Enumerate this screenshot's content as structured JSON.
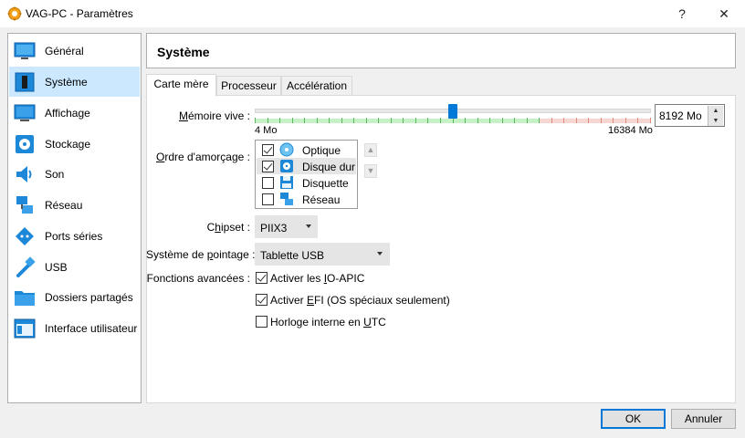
{
  "window": {
    "title": "VAG-PC - Paramètres",
    "help_glyph": "?",
    "close_glyph": "✕"
  },
  "sidebar": {
    "items": [
      {
        "label": "Général",
        "icon": "general-icon"
      },
      {
        "label": "Système",
        "icon": "system-icon",
        "selected": true
      },
      {
        "label": "Affichage",
        "icon": "display-icon"
      },
      {
        "label": "Stockage",
        "icon": "storage-icon"
      },
      {
        "label": "Son",
        "icon": "audio-icon"
      },
      {
        "label": "Réseau",
        "icon": "network-icon"
      },
      {
        "label": "Ports séries",
        "icon": "serial-ports-icon"
      },
      {
        "label": "USB",
        "icon": "usb-icon"
      },
      {
        "label": "Dossiers partagés",
        "icon": "shared-folders-icon"
      },
      {
        "label": "Interface utilisateur",
        "icon": "user-interface-icon"
      }
    ]
  },
  "header": {
    "title": "Système"
  },
  "tabs": [
    {
      "label": "Carte mère",
      "active": true
    },
    {
      "label": "Processeur"
    },
    {
      "label": "Accélération"
    }
  ],
  "motherboard": {
    "memory": {
      "label_pre": "",
      "label_u": "M",
      "label_post": "émoire vive :",
      "min_label": "4 Mo",
      "max_label": "16384 Mo",
      "value": "8192 Mo",
      "min": 4,
      "max": 16384,
      "current": 8192,
      "green_fraction": 0.72
    },
    "boot_order": {
      "label_pre": "",
      "label_u": "O",
      "label_post": "rdre d'amorçage :",
      "items": [
        {
          "label": "Optique",
          "checked": true,
          "icon": "optical-disc-icon"
        },
        {
          "label": "Disque dur",
          "checked": true,
          "icon": "hard-disk-icon",
          "selected": true
        },
        {
          "label": "Disquette",
          "checked": false,
          "icon": "floppy-icon"
        },
        {
          "label": "Réseau",
          "checked": false,
          "icon": "network-icon"
        }
      ]
    },
    "chipset": {
      "label_pre": "C",
      "label_u": "h",
      "label_post": "ipset :",
      "value": "PIIX3"
    },
    "pointing": {
      "label_pre": "Système de ",
      "label_u": "p",
      "label_post": "ointage :",
      "value": "Tablette USB"
    },
    "advanced": {
      "label": "Fonctions avancées :",
      "options": [
        {
          "pre": "Activer les ",
          "u": "I",
          "post": "O-APIC",
          "checked": true
        },
        {
          "pre": "Activer ",
          "u": "E",
          "post": "FI (OS spéciaux seulement)",
          "checked": true
        },
        {
          "pre": "Horloge interne en ",
          "u": "U",
          "post": "TC",
          "checked": false
        }
      ]
    }
  },
  "buttons": {
    "ok": "OK",
    "cancel": "Annuler"
  },
  "colors": {
    "accent": "#0078d7",
    "selection": "#cce8ff",
    "slider_green": "#c6f0c6",
    "slider_red": "#f7d5d0"
  }
}
